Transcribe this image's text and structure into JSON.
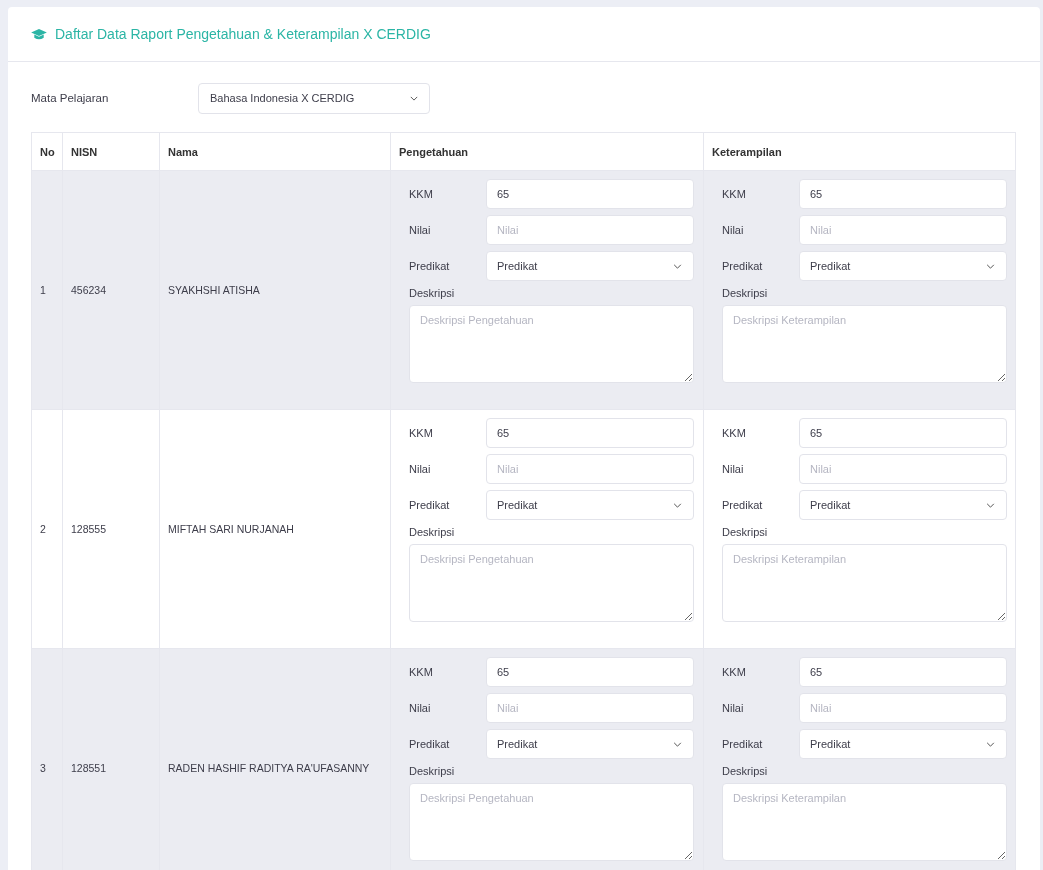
{
  "card": {
    "title": "Daftar Data Raport Pengetahuan & Keterampilan X CERDIG"
  },
  "filter": {
    "label": "Mata Pelajaran",
    "value": "Bahasa Indonesia X CERDIG"
  },
  "table": {
    "columns": [
      "No",
      "NISN",
      "Nama",
      "Pengetahuan",
      "Keterampilan"
    ],
    "rows": [
      {
        "no": "1",
        "nisn": "456234",
        "nama": "SYAKHSHI ATISHA",
        "sections": [
          {
            "kkm_label": "KKM",
            "kkm": "65",
            "nilai_label": "Nilai",
            "nilai_placeholder": "Nilai",
            "predikat_label": "Predikat",
            "predikat": "Predikat",
            "deskripsi_label": "Deskripsi",
            "deskripsi_placeholder": "Deskripsi Pengetahuan"
          },
          {
            "kkm_label": "KKM",
            "kkm": "65",
            "nilai_label": "Nilai",
            "nilai_placeholder": "Nilai",
            "predikat_label": "Predikat",
            "predikat": "Predikat",
            "deskripsi_label": "Deskripsi",
            "deskripsi_placeholder": "Deskripsi Keterampilan"
          }
        ]
      },
      {
        "no": "2",
        "nisn": "128555",
        "nama": "MIFTAH SARI NURJANAH",
        "sections": [
          {
            "kkm_label": "KKM",
            "kkm": "65",
            "nilai_label": "Nilai",
            "nilai_placeholder": "Nilai",
            "predikat_label": "Predikat",
            "predikat": "Predikat",
            "deskripsi_label": "Deskripsi",
            "deskripsi_placeholder": "Deskripsi Pengetahuan"
          },
          {
            "kkm_label": "KKM",
            "kkm": "65",
            "nilai_label": "Nilai",
            "nilai_placeholder": "Nilai",
            "predikat_label": "Predikat",
            "predikat": "Predikat",
            "deskripsi_label": "Deskripsi",
            "deskripsi_placeholder": "Deskripsi Keterampilan"
          }
        ]
      },
      {
        "no": "3",
        "nisn": "128551",
        "nama": "RADEN HASHIF RADITYA RA'UFASANNY",
        "sections": [
          {
            "kkm_label": "KKM",
            "kkm": "65",
            "nilai_label": "Nilai",
            "nilai_placeholder": "Nilai",
            "predikat_label": "Predikat",
            "predikat": "Predikat",
            "deskripsi_label": "Deskripsi",
            "deskripsi_placeholder": "Deskripsi Pengetahuan"
          },
          {
            "kkm_label": "KKM",
            "kkm": "65",
            "nilai_label": "Nilai",
            "nilai_placeholder": "Nilai",
            "predikat_label": "Predikat",
            "predikat": "Predikat",
            "deskripsi_label": "Deskripsi",
            "deskripsi_placeholder": "Deskripsi Keterampilan"
          }
        ]
      }
    ]
  }
}
